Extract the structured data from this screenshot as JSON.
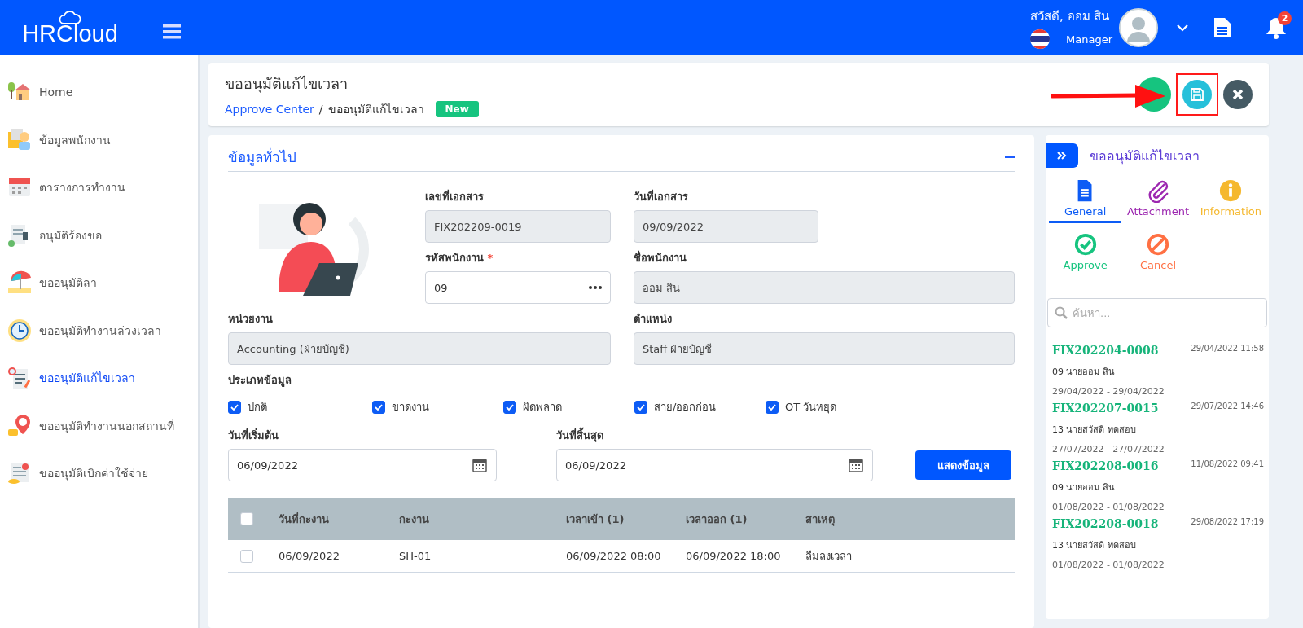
{
  "header": {
    "logo": "HRCloud",
    "greeting": "สวัสดี, ออม สิน",
    "role": "Manager",
    "notification_count": "2"
  },
  "sidebar": {
    "items": [
      {
        "label": "Home",
        "kind": "house",
        "selected": false
      },
      {
        "label": "ข้อมูลพนักงาน",
        "kind": "employee",
        "selected": false
      },
      {
        "label": "ตารางการทำงาน",
        "kind": "calendar",
        "selected": false
      },
      {
        "label": "อนุมัติร้องขอ",
        "kind": "stamp",
        "selected": false
      },
      {
        "label": "ขออนุมัติลา",
        "kind": "umbrella",
        "selected": false
      },
      {
        "label": "ขออนุมัติทำงานล่วงเวลา",
        "kind": "clock",
        "selected": false
      },
      {
        "label": "ขออนุมัติแก้ไขเวลา",
        "kind": "note",
        "selected": true
      },
      {
        "label": "ขออนุมัติทำงานนอกสถานที่",
        "kind": "pin",
        "selected": false
      },
      {
        "label": "ขออนุมัติเบิกค่าใช้จ่าย",
        "kind": "invoice",
        "selected": false
      }
    ]
  },
  "page_header": {
    "title": "ขออนุมัติแก้ไขเวลา",
    "breadcrumb_separator": "/",
    "breadcrumb": [
      {
        "label": "Approve Center",
        "kind": "link"
      },
      {
        "label": "ขออนุมัติแก้ไขเวลา",
        "kind": "current"
      }
    ],
    "status_badge": "New",
    "annotation": {
      "arrow": true,
      "highlight": true
    }
  },
  "general": {
    "title": "ข้อมูลทั่วไป",
    "fields": [
      {
        "label": "เลขที่เอกสาร",
        "value": "FIX202209-0019",
        "readonly": true
      },
      {
        "label": "วันที่เอกสาร",
        "value": "09/09/2022",
        "readonly": true
      },
      {
        "label": "รหัสพนักงาน",
        "required_mark": "*",
        "value": "09",
        "readonly": false
      },
      {
        "label": "ชื่อพนักงาน",
        "value": "ออม สิน",
        "readonly": true
      },
      {
        "label": "หน่วยงาน",
        "value": "Accounting (ฝ่ายบัญชี)",
        "readonly": true
      },
      {
        "label": "ตำแหน่ง",
        "value": "Staff ฝ่ายบัญชี",
        "readonly": true
      }
    ],
    "type_label": "ประเภทข้อมูล",
    "types": [
      {
        "label": "ปกติ",
        "checked": true
      },
      {
        "label": "ขาดงาน",
        "checked": true
      },
      {
        "label": "ผิดพลาด",
        "checked": true
      },
      {
        "label": "สาย/ออกก่อน",
        "checked": true
      },
      {
        "label": "OT วันหยุด",
        "checked": true
      }
    ],
    "start_date": {
      "label": "วันที่เริ่มต้น",
      "value": "06/09/2022"
    },
    "end_date": {
      "label": "วันที่สิ้นสุด",
      "value": "06/09/2022"
    },
    "show_button": "แสดงข้อมูล",
    "table": {
      "all_checked": false,
      "columns": [
        "วันที่กะงาน",
        "กะงาน",
        "เวลาเข้า (1)",
        "เวลาออก (1)",
        "สาเหตุ"
      ],
      "rows": [
        {
          "checked": false,
          "cells": [
            "06/09/2022",
            "SH-01",
            "06/09/2022 08:00",
            "06/09/2022 18:00",
            "ลืมลงเวลา"
          ]
        }
      ]
    }
  },
  "side_panel": {
    "title": "ขออนุมัติแก้ไขเวลา",
    "tabs": [
      {
        "label": "General",
        "kind": "document",
        "color": "#0d5cf5",
        "selected": true
      },
      {
        "label": "Attachment",
        "kind": "paperclip",
        "color": "#9c27b0",
        "selected": false
      },
      {
        "label": "Information",
        "kind": "info",
        "color": "#f5b82e",
        "selected": false
      },
      {
        "label": "Approve",
        "kind": "check",
        "color": "#16c47f",
        "selected": false
      },
      {
        "label": "Cancel",
        "kind": "ban",
        "color": "#ff7043",
        "selected": false
      }
    ],
    "search": {
      "placeholder": "ค้นหา..."
    },
    "documents": [
      {
        "number": "FIX202204-0008",
        "timestamp": "29/04/2022 11:58",
        "employee": "09 นายออม สิน",
        "range": "29/04/2022 - 29/04/2022"
      },
      {
        "number": "FIX202207-0015",
        "timestamp": "29/07/2022 14:46",
        "employee": "13 นายสวัสดี ทดสอบ",
        "range": "27/07/2022 - 27/07/2022"
      },
      {
        "number": "FIX202208-0016",
        "timestamp": "11/08/2022 09:41",
        "employee": "09 นายออม สิน",
        "range": "01/08/2022 - 01/08/2022"
      },
      {
        "number": "FIX202208-0018",
        "timestamp": "29/08/2022 17:19",
        "employee": "13 นายสวัสดี ทดสอบ",
        "range": "01/08/2022 - 01/08/2022"
      }
    ]
  }
}
